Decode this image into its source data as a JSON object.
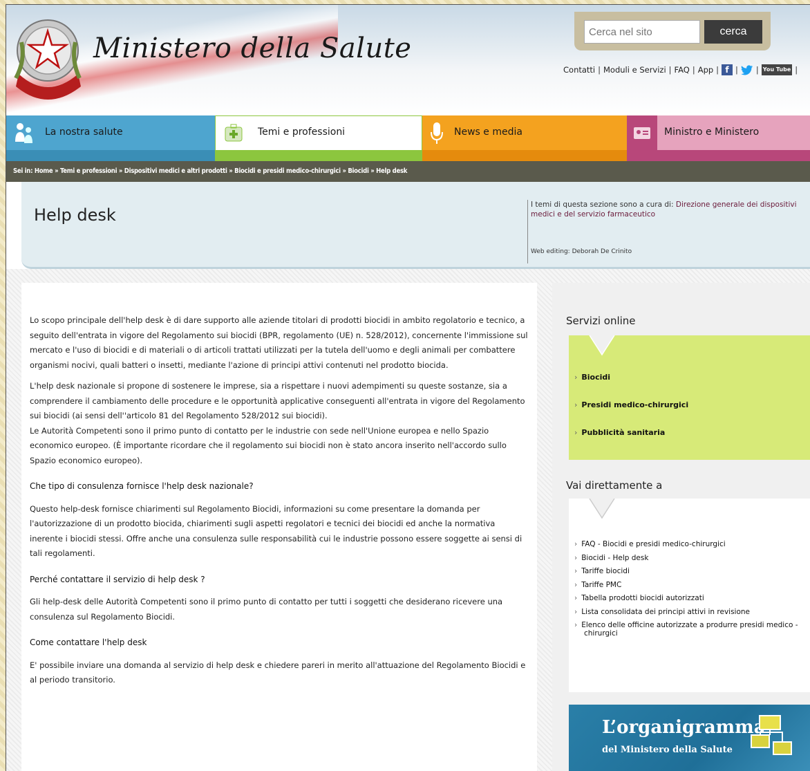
{
  "header": {
    "logo_text": "Ministero della Salute",
    "search": {
      "placeholder": "Cerca nel sito",
      "button": "cerca"
    },
    "toplinks": [
      "Contatti",
      "Moduli e Servizi",
      "FAQ",
      "App"
    ],
    "social": [
      "facebook-icon",
      "twitter-icon",
      "youtube-icon"
    ],
    "social_labels": {
      "facebook": "f",
      "youtube": "You Tube"
    }
  },
  "nav": {
    "items": [
      {
        "label": "La nostra salute",
        "color": "#4ea5cf",
        "color2": "#3a8eb6"
      },
      {
        "label": "Temi e professioni",
        "color": "#ffffff",
        "color2": "#8cc63e"
      },
      {
        "label": "News e media",
        "color": "#f4a21f",
        "color2": "#e58b0d"
      },
      {
        "label": "Ministro e Ministero",
        "color": "#e6a3bd",
        "color2": "#b8477a"
      }
    ]
  },
  "breadcrumb": "Sei in: Home » Temi e professioni » Dispositivi medici e altri prodotti » Biocidi e presidi medico-chirurgici » Biocidi » Help desk",
  "title": {
    "page_title": "Help desk",
    "cura_prefix": "I temi di questa sezione sono a cura di: ",
    "cura_dir": "Direzione generale dei dispositivi medici e del servizio farmaceutico",
    "web_editing": "Web editing: Deborah De Crinito"
  },
  "main": {
    "p1": "Lo scopo principale dell'help desk è di dare supporto alle aziende titolari di prodotti biocidi in ambito regolatorio e tecnico, a seguito dell'entrata in vigore del Regolamento sui biocidi (BPR, regolamento (UE) n. 528/2012), concernente l'immissione sul mercato e l'uso di biocidi e di materiali o di articoli trattati utilizzati per la tutela dell'uomo e degli animali per combattere organismi nocivi, quali batteri o insetti, mediante l'azione di principi attivi contenuti nel prodotto biocida.",
    "p2": "L'help desk nazionale si propone di sostenere le imprese, sia a rispettare i nuovi adempimenti su queste sostanze, sia a comprendere il cambiamento delle procedure e le opportunità applicative conseguenti all'entrata in vigore del Regolamento sui biocidi (ai sensi dell''articolo 81 del Regolamento 528/2012 sui biocidi).",
    "p3": "Le Autorità Competenti sono il primo punto di contatto per le industrie con sede nell'Unione europea e nello Spazio economico europeo. (È importante ricordare che il regolamento sui biocidi non è stato ancora inserito nell'accordo sullo Spazio economico europeo).",
    "h1": "Che tipo di consulenza fornisce l'help desk nazionale?",
    "p4": "Questo help-desk fornisce chiarimenti sul Regolamento Biocidi, informazioni su come presentare la domanda per l'autorizzazione di un prodotto biocida, chiarimenti sugli aspetti regolatori e tecnici dei biocidi ed anche la normativa inerente i biocidi stessi. Offre anche una consulenza sulle responsabilità cui le industrie possono essere soggette ai sensi di tali regolamenti.",
    "h2": "Perché contattare il servizio di help desk ?",
    "p5": "Gli help-desk delle Autorità Competenti sono il primo punto di contatto per tutti i soggetti che desiderano ricevere una consulenza sul Regolamento Biocidi.",
    "h3": "Come contattare l'help desk",
    "p6": "E' possibile inviare una domanda al servizio di help desk e chiedere pareri in merito all'attuazione del Regolamento Biocidi e al periodo transitorio."
  },
  "sidebar": {
    "servizi_title": "Servizi online",
    "servizi": [
      "Biocidi",
      "Presidi medico-chirurgici",
      "Pubblicità sanitaria"
    ],
    "vai_title": "Vai direttamente a",
    "vai": [
      "FAQ - Biocidi e presidi medico-chirurgici",
      "Biocidi - Help desk",
      "Tariffe biocidi",
      "Tariffe PMC",
      "Tabella prodotti biocidi autorizzati",
      "Lista consolidata dei principi attivi in revisione",
      "Elenco delle officine autorizzate a produrre presidi medico - chirurgici"
    ],
    "banner_big": "L’organigramma",
    "banner_small": "del Ministero della Salute"
  }
}
